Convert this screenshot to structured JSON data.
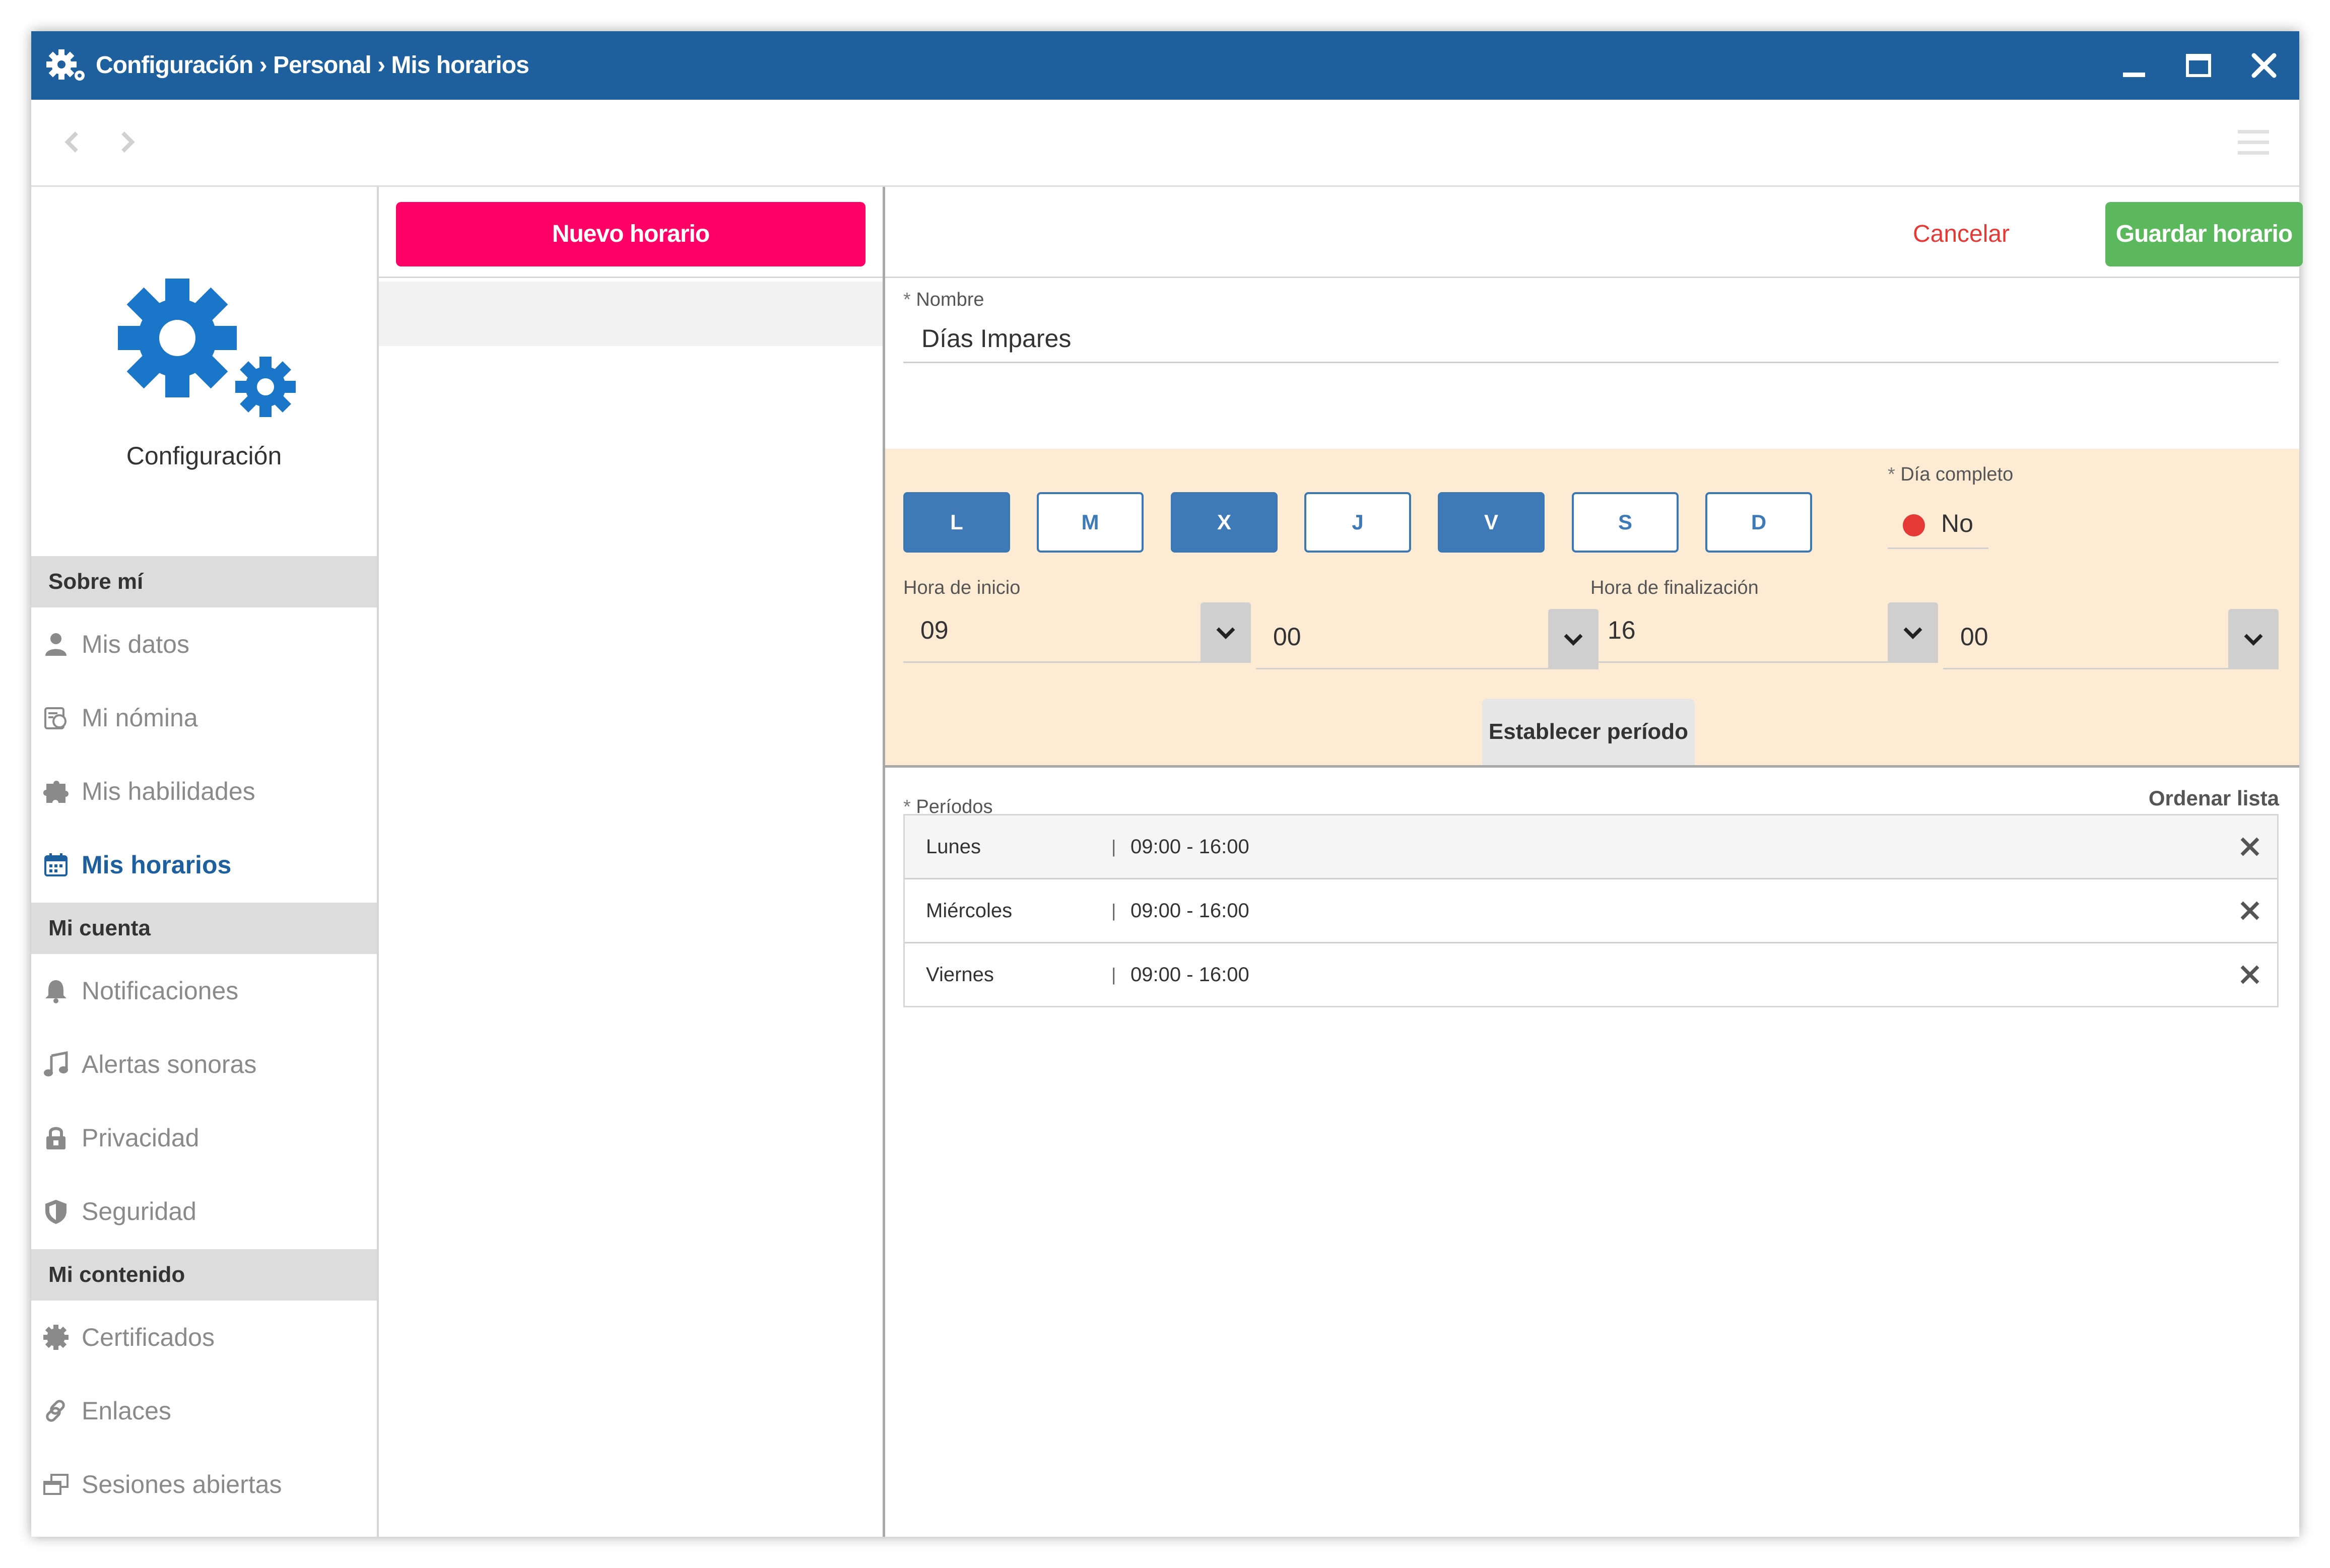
{
  "window": {
    "title": "Configuración › Personal › Mis horarios",
    "accent_color": "#1e5f9e",
    "controls": [
      "minimize-icon",
      "maximize-icon",
      "close-icon"
    ]
  },
  "toolbar": {
    "back_icon": "chevron-left-icon",
    "forward_icon": "chevron-right-icon",
    "menu_icon": "hamburger-menu-icon"
  },
  "sidebar": {
    "header_icon": "gears-icon",
    "header_label": "Configuración",
    "sections": [
      {
        "title": "Sobre mí",
        "items": [
          {
            "label": "Mis datos",
            "icon": "user-icon"
          },
          {
            "label": "Mi nómina",
            "icon": "payslip-icon"
          },
          {
            "label": "Mis habilidades",
            "icon": "puzzle-icon"
          },
          {
            "label": "Mis horarios",
            "icon": "calendar-icon",
            "active": true
          }
        ]
      },
      {
        "title": "Mi cuenta",
        "items": [
          {
            "label": "Notificaciones",
            "icon": "bell-icon"
          },
          {
            "label": "Alertas sonoras",
            "icon": "music-note-icon"
          },
          {
            "label": "Privacidad",
            "icon": "lock-icon"
          },
          {
            "label": "Seguridad",
            "icon": "shield-icon"
          }
        ]
      },
      {
        "title": "Mi contenido",
        "items": [
          {
            "label": "Certificados",
            "icon": "certificate-icon"
          },
          {
            "label": "Enlaces",
            "icon": "link-icon"
          },
          {
            "label": "Sesiones abiertas",
            "icon": "windows-icon"
          }
        ]
      }
    ]
  },
  "list": {
    "new_button": "Nuevo horario",
    "new_button_color": "#ff0066"
  },
  "editor": {
    "cancel_label": "Cancelar",
    "save_label": "Guardar horario",
    "save_color": "#5cb85c",
    "name": {
      "label": "Nombre",
      "required_mark": "*",
      "value": "Días Impares"
    },
    "days": [
      {
        "label": "L",
        "selected": true
      },
      {
        "label": "M",
        "selected": false
      },
      {
        "label": "X",
        "selected": true
      },
      {
        "label": "J",
        "selected": false
      },
      {
        "label": "V",
        "selected": true
      },
      {
        "label": "S",
        "selected": false
      },
      {
        "label": "D",
        "selected": false
      }
    ],
    "full_day": {
      "label": "Día completo",
      "required_mark": "*",
      "value": "No",
      "indicator_color": "#e53935"
    },
    "start": {
      "label": "Hora de inicio",
      "hour": "09",
      "minute": "00"
    },
    "end": {
      "label": "Hora de finalización",
      "hour": "16",
      "minute": "00"
    },
    "set_period_label": "Establecer período",
    "periods_label": "Períodos",
    "periods_required_mark": "*",
    "order_list_label": "Ordenar lista",
    "periods": [
      {
        "day": "Lunes",
        "separator": "|",
        "time": "09:00 - 16:00"
      },
      {
        "day": "Miércoles",
        "separator": "|",
        "time": "09:00 - 16:00"
      },
      {
        "day": "Viernes",
        "separator": "|",
        "time": "09:00 - 16:00"
      }
    ],
    "highlight_color": "#fdecd3"
  }
}
